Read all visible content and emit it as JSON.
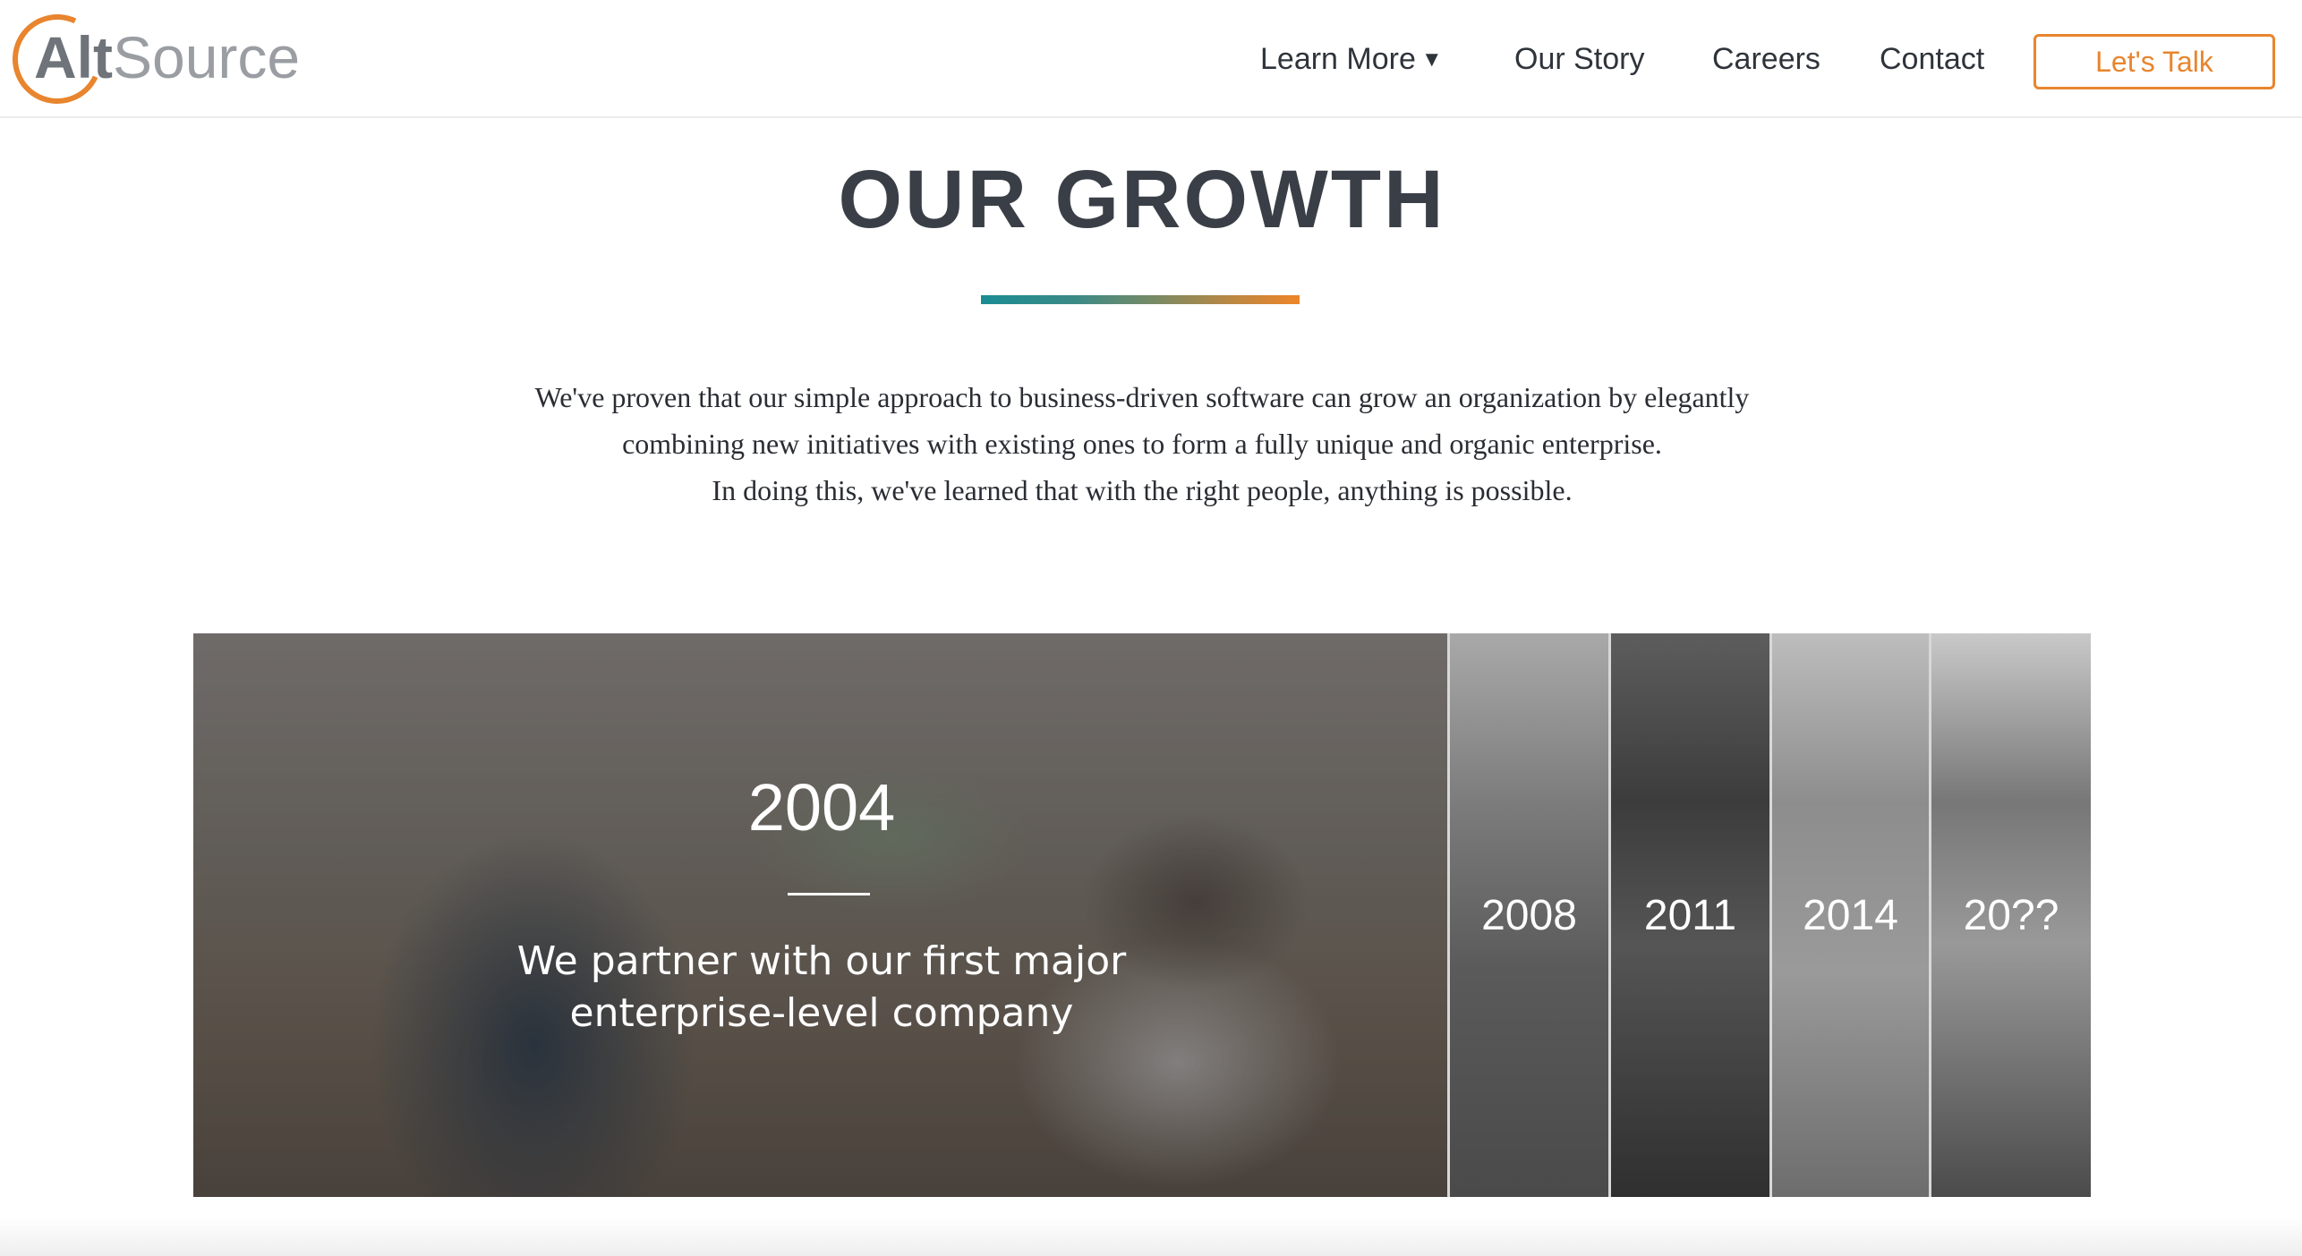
{
  "header": {
    "logo_prefix": "Alt",
    "logo_suffix": "Source",
    "nav": {
      "learn_more": "Learn More",
      "learn_more_caret": "▼",
      "our_story": "Our Story",
      "careers": "Careers",
      "contact": "Contact",
      "cta": "Let's Talk"
    }
  },
  "colors": {
    "accent": "#e8852e",
    "heading": "#3a3f47",
    "gradient_start": "#1a8c93",
    "gradient_end": "#ee8529"
  },
  "main": {
    "title": "OUR GROWTH",
    "intro": [
      "We've proven that our simple approach to business-driven software can grow an organization by elegantly",
      "combining new initiatives with existing ones to form a fully unique and organic enterprise.",
      "In doing this, we've learned that with the right people, anything is possible."
    ]
  },
  "timeline": {
    "active": {
      "year": "2004",
      "description_line1": "We partner with our first major",
      "description_line2": "enterprise-level company"
    },
    "collapsed": [
      "2008",
      "2011",
      "2014",
      "20??"
    ]
  }
}
